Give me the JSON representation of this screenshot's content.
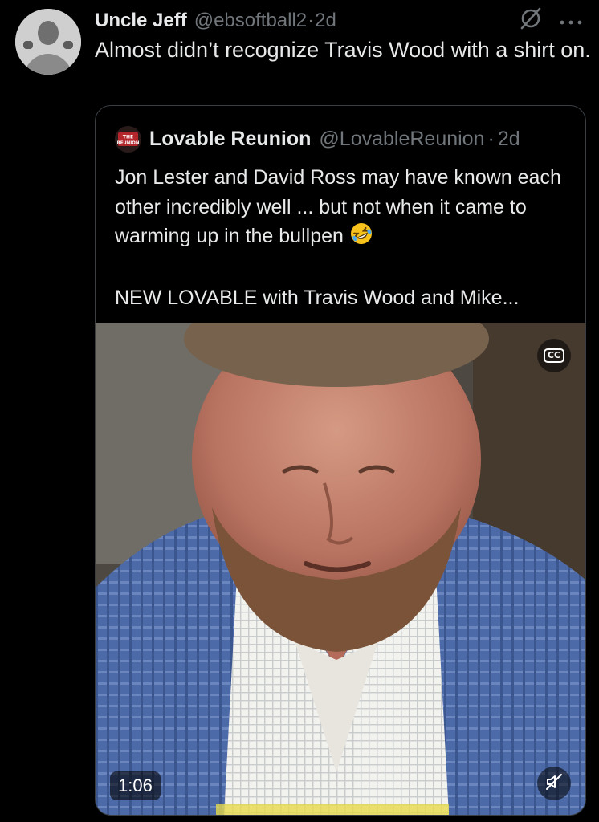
{
  "tweet": {
    "author_name": "Uncle Jeff",
    "author_handle": "@ebsoftball2",
    "separator": "·",
    "time": "2d",
    "text": "Almost didn’t recognize Travis Wood with a shirt on.",
    "icons": [
      "grok-icon",
      "more-icon"
    ]
  },
  "quote": {
    "logo_text": "THE REUNION",
    "author_name": "Lovable Reunion",
    "author_handle": "@LovableReunion",
    "separator": "·",
    "time": "2d",
    "text_para1": "Jon Lester and David Ross may have known each other incredibly well ... but not when it came to warming up in the bullpen",
    "emoji": "rolling-on-floor-laughing-emoji",
    "text_para2": "NEW LOVABLE with Travis Wood and Mike...",
    "video": {
      "duration": "1:06",
      "cc_label": "CC",
      "icons": [
        "closed-captions-icon",
        "muted-speaker-icon"
      ]
    }
  },
  "colors": {
    "background": "#000000",
    "text": "#e7e9ea",
    "muted": "#71767b",
    "border": "#3a3f44"
  }
}
